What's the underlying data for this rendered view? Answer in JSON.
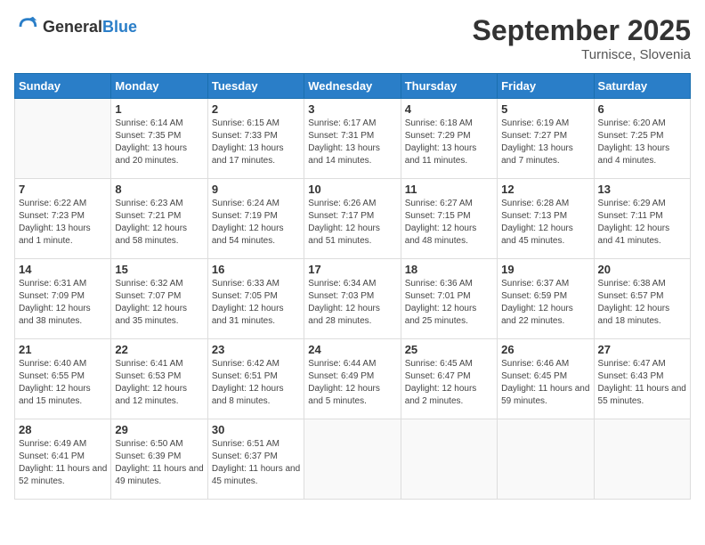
{
  "header": {
    "logo_general": "General",
    "logo_blue": "Blue",
    "month_title": "September 2025",
    "location": "Turnisce, Slovenia"
  },
  "days_of_week": [
    "Sunday",
    "Monday",
    "Tuesday",
    "Wednesday",
    "Thursday",
    "Friday",
    "Saturday"
  ],
  "weeks": [
    [
      {
        "day": "",
        "sunrise": "",
        "sunset": "",
        "daylight": ""
      },
      {
        "day": "1",
        "sunrise": "Sunrise: 6:14 AM",
        "sunset": "Sunset: 7:35 PM",
        "daylight": "Daylight: 13 hours and 20 minutes."
      },
      {
        "day": "2",
        "sunrise": "Sunrise: 6:15 AM",
        "sunset": "Sunset: 7:33 PM",
        "daylight": "Daylight: 13 hours and 17 minutes."
      },
      {
        "day": "3",
        "sunrise": "Sunrise: 6:17 AM",
        "sunset": "Sunset: 7:31 PM",
        "daylight": "Daylight: 13 hours and 14 minutes."
      },
      {
        "day": "4",
        "sunrise": "Sunrise: 6:18 AM",
        "sunset": "Sunset: 7:29 PM",
        "daylight": "Daylight: 13 hours and 11 minutes."
      },
      {
        "day": "5",
        "sunrise": "Sunrise: 6:19 AM",
        "sunset": "Sunset: 7:27 PM",
        "daylight": "Daylight: 13 hours and 7 minutes."
      },
      {
        "day": "6",
        "sunrise": "Sunrise: 6:20 AM",
        "sunset": "Sunset: 7:25 PM",
        "daylight": "Daylight: 13 hours and 4 minutes."
      }
    ],
    [
      {
        "day": "7",
        "sunrise": "Sunrise: 6:22 AM",
        "sunset": "Sunset: 7:23 PM",
        "daylight": "Daylight: 13 hours and 1 minute."
      },
      {
        "day": "8",
        "sunrise": "Sunrise: 6:23 AM",
        "sunset": "Sunset: 7:21 PM",
        "daylight": "Daylight: 12 hours and 58 minutes."
      },
      {
        "day": "9",
        "sunrise": "Sunrise: 6:24 AM",
        "sunset": "Sunset: 7:19 PM",
        "daylight": "Daylight: 12 hours and 54 minutes."
      },
      {
        "day": "10",
        "sunrise": "Sunrise: 6:26 AM",
        "sunset": "Sunset: 7:17 PM",
        "daylight": "Daylight: 12 hours and 51 minutes."
      },
      {
        "day": "11",
        "sunrise": "Sunrise: 6:27 AM",
        "sunset": "Sunset: 7:15 PM",
        "daylight": "Daylight: 12 hours and 48 minutes."
      },
      {
        "day": "12",
        "sunrise": "Sunrise: 6:28 AM",
        "sunset": "Sunset: 7:13 PM",
        "daylight": "Daylight: 12 hours and 45 minutes."
      },
      {
        "day": "13",
        "sunrise": "Sunrise: 6:29 AM",
        "sunset": "Sunset: 7:11 PM",
        "daylight": "Daylight: 12 hours and 41 minutes."
      }
    ],
    [
      {
        "day": "14",
        "sunrise": "Sunrise: 6:31 AM",
        "sunset": "Sunset: 7:09 PM",
        "daylight": "Daylight: 12 hours and 38 minutes."
      },
      {
        "day": "15",
        "sunrise": "Sunrise: 6:32 AM",
        "sunset": "Sunset: 7:07 PM",
        "daylight": "Daylight: 12 hours and 35 minutes."
      },
      {
        "day": "16",
        "sunrise": "Sunrise: 6:33 AM",
        "sunset": "Sunset: 7:05 PM",
        "daylight": "Daylight: 12 hours and 31 minutes."
      },
      {
        "day": "17",
        "sunrise": "Sunrise: 6:34 AM",
        "sunset": "Sunset: 7:03 PM",
        "daylight": "Daylight: 12 hours and 28 minutes."
      },
      {
        "day": "18",
        "sunrise": "Sunrise: 6:36 AM",
        "sunset": "Sunset: 7:01 PM",
        "daylight": "Daylight: 12 hours and 25 minutes."
      },
      {
        "day": "19",
        "sunrise": "Sunrise: 6:37 AM",
        "sunset": "Sunset: 6:59 PM",
        "daylight": "Daylight: 12 hours and 22 minutes."
      },
      {
        "day": "20",
        "sunrise": "Sunrise: 6:38 AM",
        "sunset": "Sunset: 6:57 PM",
        "daylight": "Daylight: 12 hours and 18 minutes."
      }
    ],
    [
      {
        "day": "21",
        "sunrise": "Sunrise: 6:40 AM",
        "sunset": "Sunset: 6:55 PM",
        "daylight": "Daylight: 12 hours and 15 minutes."
      },
      {
        "day": "22",
        "sunrise": "Sunrise: 6:41 AM",
        "sunset": "Sunset: 6:53 PM",
        "daylight": "Daylight: 12 hours and 12 minutes."
      },
      {
        "day": "23",
        "sunrise": "Sunrise: 6:42 AM",
        "sunset": "Sunset: 6:51 PM",
        "daylight": "Daylight: 12 hours and 8 minutes."
      },
      {
        "day": "24",
        "sunrise": "Sunrise: 6:44 AM",
        "sunset": "Sunset: 6:49 PM",
        "daylight": "Daylight: 12 hours and 5 minutes."
      },
      {
        "day": "25",
        "sunrise": "Sunrise: 6:45 AM",
        "sunset": "Sunset: 6:47 PM",
        "daylight": "Daylight: 12 hours and 2 minutes."
      },
      {
        "day": "26",
        "sunrise": "Sunrise: 6:46 AM",
        "sunset": "Sunset: 6:45 PM",
        "daylight": "Daylight: 11 hours and 59 minutes."
      },
      {
        "day": "27",
        "sunrise": "Sunrise: 6:47 AM",
        "sunset": "Sunset: 6:43 PM",
        "daylight": "Daylight: 11 hours and 55 minutes."
      }
    ],
    [
      {
        "day": "28",
        "sunrise": "Sunrise: 6:49 AM",
        "sunset": "Sunset: 6:41 PM",
        "daylight": "Daylight: 11 hours and 52 minutes."
      },
      {
        "day": "29",
        "sunrise": "Sunrise: 6:50 AM",
        "sunset": "Sunset: 6:39 PM",
        "daylight": "Daylight: 11 hours and 49 minutes."
      },
      {
        "day": "30",
        "sunrise": "Sunrise: 6:51 AM",
        "sunset": "Sunset: 6:37 PM",
        "daylight": "Daylight: 11 hours and 45 minutes."
      },
      {
        "day": "",
        "sunrise": "",
        "sunset": "",
        "daylight": ""
      },
      {
        "day": "",
        "sunrise": "",
        "sunset": "",
        "daylight": ""
      },
      {
        "day": "",
        "sunrise": "",
        "sunset": "",
        "daylight": ""
      },
      {
        "day": "",
        "sunrise": "",
        "sunset": "",
        "daylight": ""
      }
    ]
  ]
}
